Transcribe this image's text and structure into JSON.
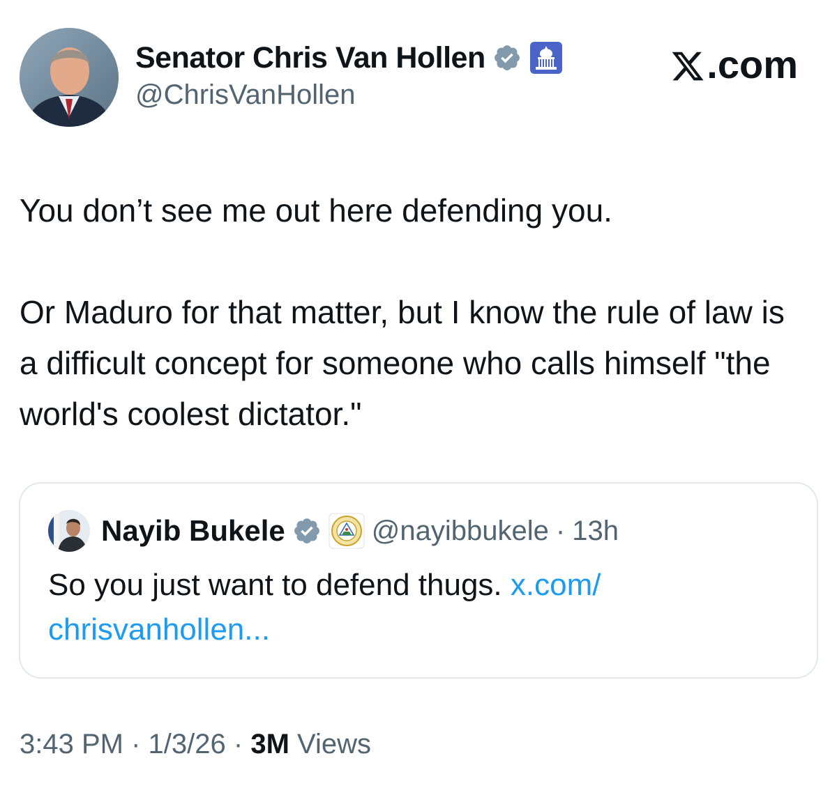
{
  "tweet": {
    "author": {
      "display_name": "Senator Chris Van Hollen",
      "handle": "@ChrisVanHollen",
      "verified_icon": "verified-badge-icon",
      "affiliation_icon": "capitol-icon"
    },
    "source_label": ".com",
    "text_paragraphs": [
      "You don’t see me out here defending you.",
      "Or Maduro for that matter, but I know the rule of law is a difficult concept for someone who calls himself \"the world's coolest dictator.\""
    ],
    "quoted": {
      "display_name": "Nayib Bukele",
      "handle": "@nayibbukele",
      "separator": "·",
      "time": "13h",
      "text": "So you just want to defend thugs.",
      "link_text": "x.com/ chrisvanhollen..."
    },
    "meta": {
      "time": "3:43 PM",
      "sep1": "·",
      "date": "1/3/26",
      "sep2": "·",
      "views_count": "3M",
      "views_label": "Views"
    }
  },
  "colors": {
    "text": "#0f1419",
    "secondary": "#536471",
    "link": "#1d9bf0",
    "verified_blue": "#829aab",
    "border": "#e4e8eb"
  }
}
